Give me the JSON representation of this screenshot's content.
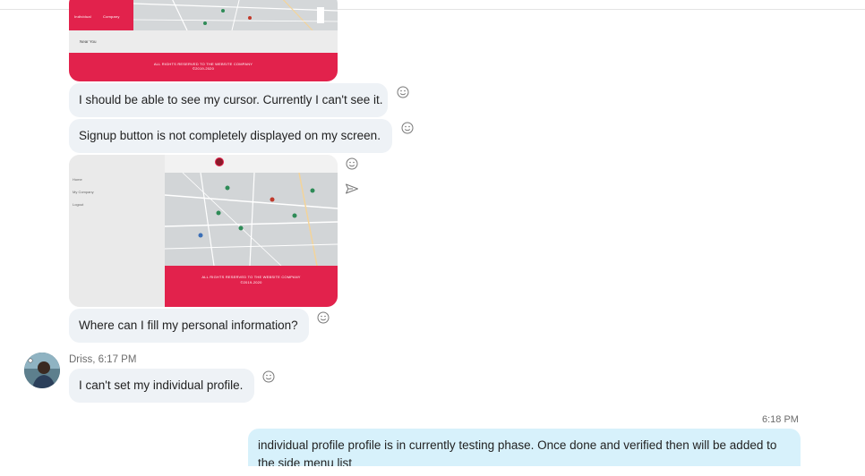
{
  "messages": [
    {
      "text": "I should be able to see my cursor. Currently I can't see it."
    },
    {
      "text": "Signup button is not completely displayed on my screen."
    },
    {
      "text": "Where can I fill my personal information?"
    }
  ],
  "incoming": {
    "sender": "Driss, 6:17 PM",
    "text": "I can't set my individual profile."
  },
  "outgoing": {
    "time": "6:18 PM",
    "text": "individual profile profile is in currently testing phase. Once done and verified then will be added to the side menu list"
  },
  "screenshot1": {
    "tabs": [
      "Individual",
      "Company"
    ],
    "near_you": "Near You",
    "footer_line1": "ALL RIGHTS RESERVED TO THE WEBSITE COMPANY",
    "footer_line2": "©2019-2020"
  },
  "screenshot2": {
    "menu": [
      "Home",
      "My Company",
      "Logout"
    ],
    "footer_line1": "ALL RIGHTS RESERVED TO THE WEBSITE COMPANY",
    "footer_line2": "©2019-2020"
  },
  "icons": {
    "reaction": "smiley-face-icon",
    "forward": "send-arrow-icon",
    "avatar": "user-avatar"
  },
  "colors": {
    "incoming_bubble": "#eef2f6",
    "outgoing_bubble": "#d7f1fb",
    "accent_red": "#e2224c"
  }
}
